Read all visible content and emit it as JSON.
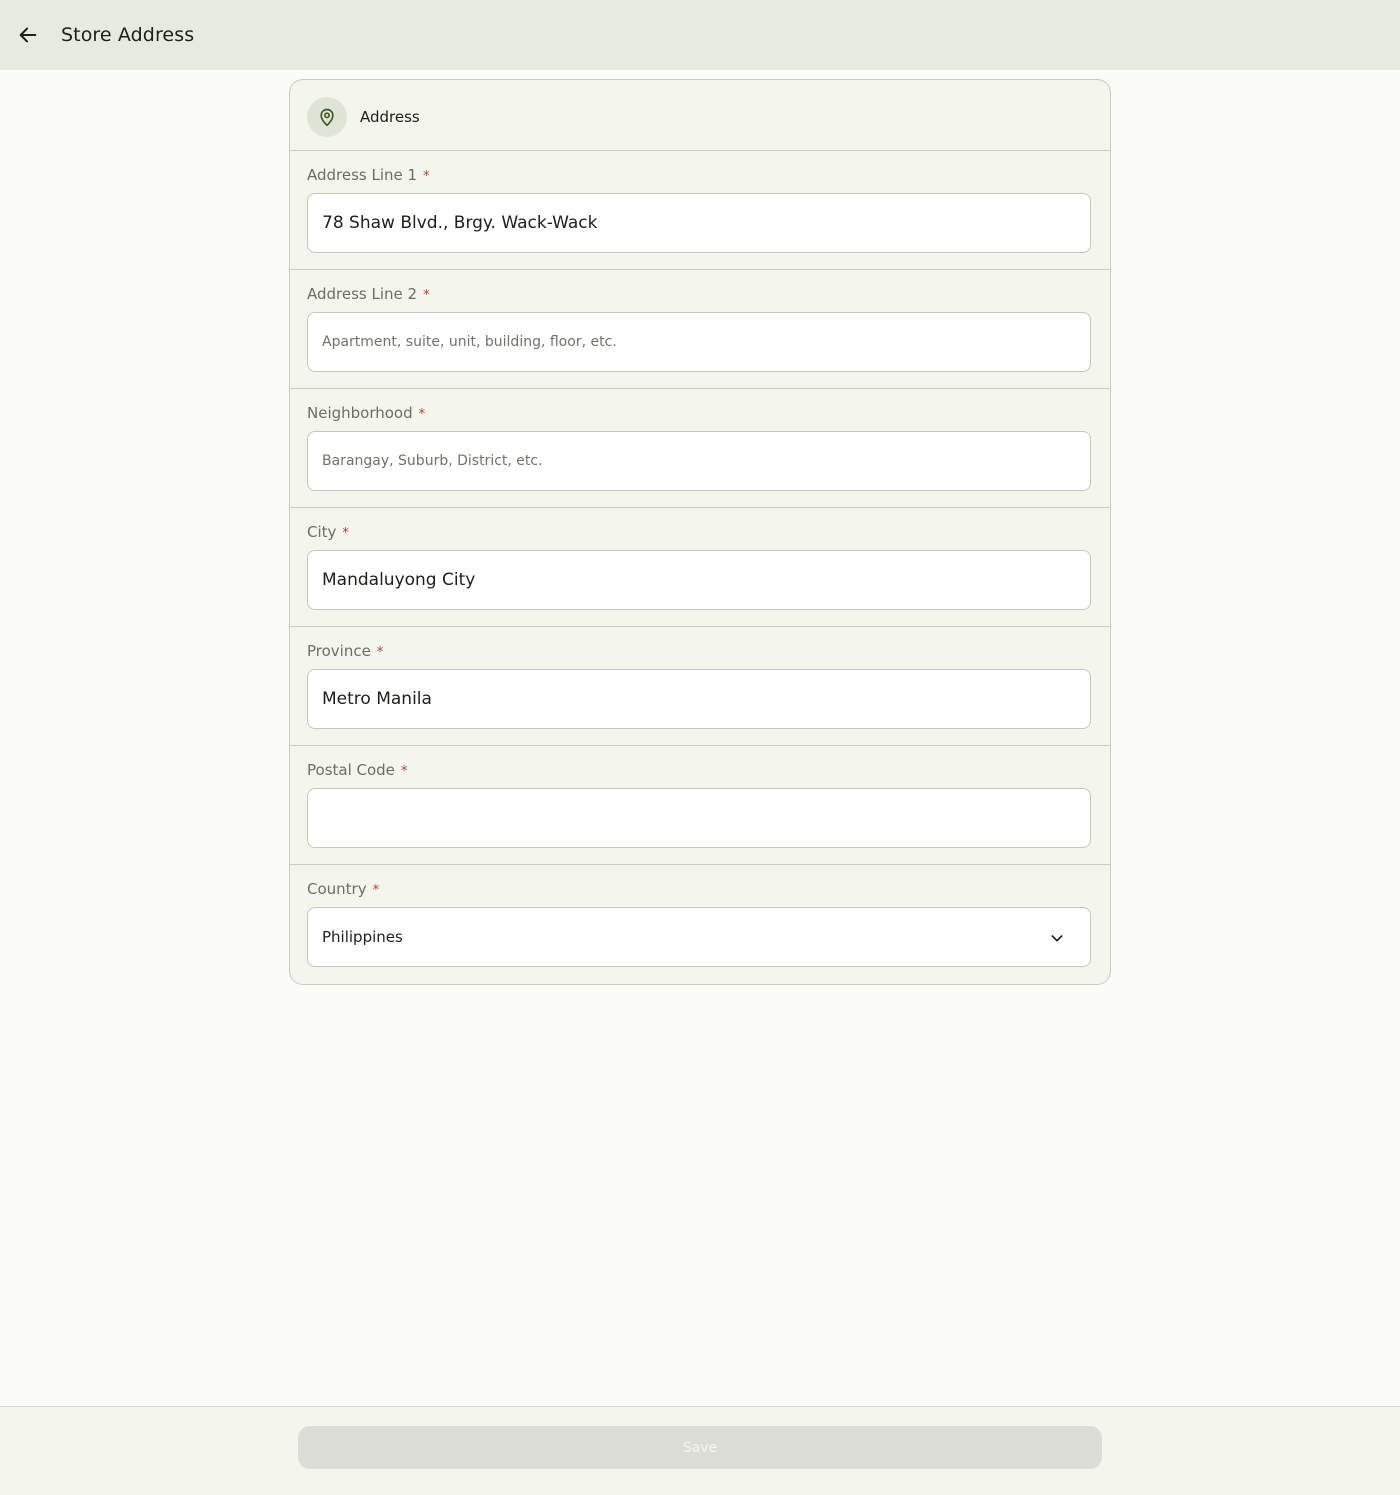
{
  "header": {
    "title": "Store Address",
    "back_icon": "arrow-left-icon"
  },
  "card": {
    "title": "Address",
    "icon": "location-pin-icon",
    "required_marker": "*",
    "fields": {
      "address_line_1": {
        "label": "Address Line 1",
        "value": "78 Shaw Blvd., Brgy. Wack-Wack",
        "placeholder": ""
      },
      "address_line_2": {
        "label": "Address Line 2",
        "value": "",
        "placeholder": "Apartment, suite, unit, building, floor, etc."
      },
      "neighborhood": {
        "label": "Neighborhood",
        "value": "",
        "placeholder": "Barangay, Suburb, District, etc."
      },
      "city": {
        "label": "City",
        "value": "Mandaluyong City",
        "placeholder": ""
      },
      "province": {
        "label": "Province",
        "value": "Metro Manila",
        "placeholder": ""
      },
      "postal_code": {
        "label": "Postal Code",
        "value": "",
        "placeholder": ""
      },
      "country": {
        "label": "Country",
        "selected": "Philippines",
        "icon": "chevron-down-icon"
      }
    }
  },
  "footer": {
    "save_label": "Save",
    "save_enabled": false
  },
  "colors": {
    "header_bg": "#e6ebdf",
    "page_bg": "#fbfcf8",
    "card_bg": "#f4f6ee",
    "icon_accent": "#3d5a2a",
    "required": "#c43a2c",
    "save_disabled_bg": "#dcddd6"
  }
}
